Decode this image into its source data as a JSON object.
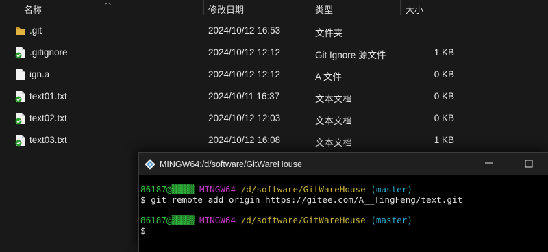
{
  "columns": {
    "name": "名称",
    "modified": "修改日期",
    "type": "类型",
    "size": "大小"
  },
  "files": [
    {
      "name": ".git",
      "modified": "2024/10/12 16:53",
      "type": "文件夹",
      "size": "",
      "icon": "folder-icon"
    },
    {
      "name": ".gitignore",
      "modified": "2024/10/12 12:12",
      "type": "Git Ignore 源文件",
      "size": "1 KB",
      "icon": "git-file-icon"
    },
    {
      "name": "ign.a",
      "modified": "2024/10/12 12:12",
      "type": "A 文件",
      "size": "0 KB",
      "icon": "blank-file-icon"
    },
    {
      "name": "text01.txt",
      "modified": "2024/10/11 16:37",
      "type": "文本文档",
      "size": "0 KB",
      "icon": "git-file-icon"
    },
    {
      "name": "text02.txt",
      "modified": "2024/10/12 12:03",
      "type": "文本文档",
      "size": "0 KB",
      "icon": "git-file-icon"
    },
    {
      "name": "text03.txt",
      "modified": "2024/10/12 16:08",
      "type": "文本文档",
      "size": "1 KB",
      "icon": "git-file-icon"
    }
  ],
  "terminal": {
    "title": "MINGW64:/d/software/GitWareHouse",
    "user": "86187@",
    "host_masked": "▒▒▒▒▒",
    "env": "MINGW64",
    "path": "/d/software/GitWareHouse",
    "branch": "(master)",
    "prompt": "$",
    "command": "git remote add origin https://gitee.com/A__TingFeng/text.git"
  },
  "colors": {
    "background": "#191919",
    "terminal_bg": "#000000",
    "user_green": "#2fc43f",
    "env_magenta": "#c236c2",
    "path_yellow": "#c9b338",
    "branch_cyan": "#27a6c6"
  }
}
